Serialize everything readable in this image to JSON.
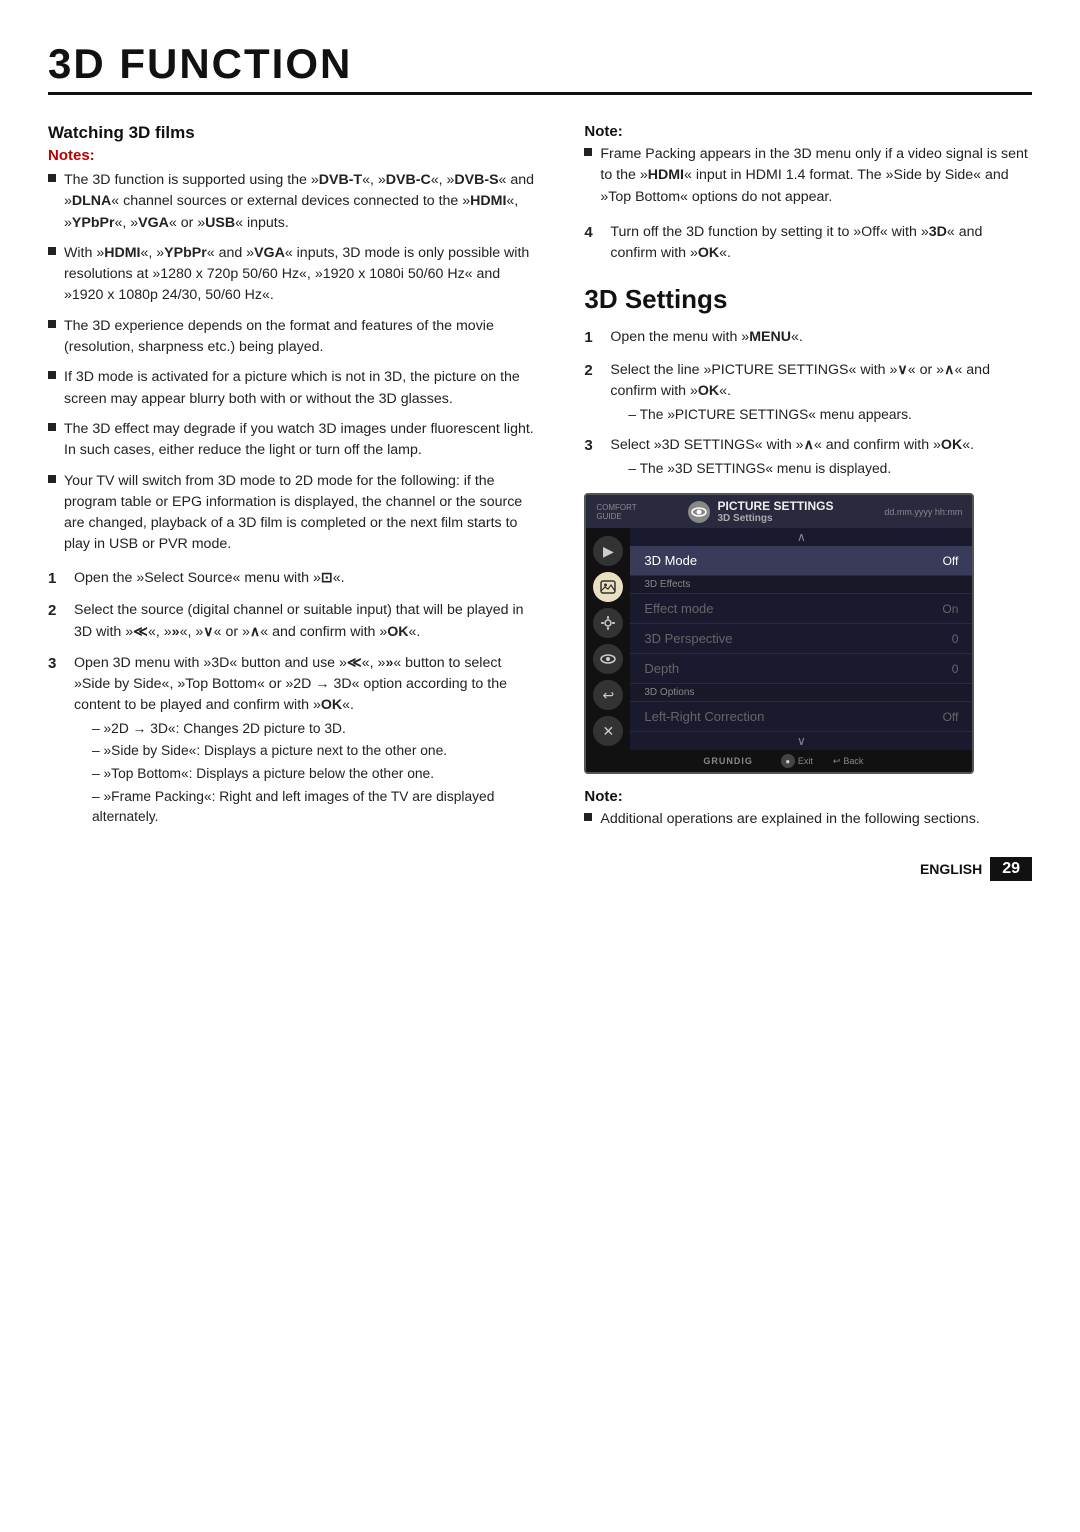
{
  "page": {
    "title": "3D FUNCTION",
    "footer_lang": "ENGLISH",
    "footer_page": "29"
  },
  "left_col": {
    "watching_heading": "Watching 3D films",
    "notes_label": "Notes:",
    "notes": [
      "The 3D function is supported using the »DVB-T«, »DVB-C«, »DVB-S« and »DLNA« channel sources or external devices connected to the »HDMI«, »YPbPr«, »VGA« or »USB« inputs.",
      "With »HDMI«, »YPbPr« and »VGA« inputs, 3D mode is only possible with resolutions at »1280 x 720p 50/60 Hz«, »1920 x 1080i 50/60 Hz« and »1920 x 1080p 24/30, 50/60 Hz«.",
      "The 3D experience depends on the format and features of the movie (resolution, sharpness etc.) being played.",
      "If 3D mode is activated for a picture which is not in 3D, the picture on the screen may appear blurry both with or without the 3D glasses.",
      "The 3D effect may degrade if you watch 3D images under fluorescent light. In such cases, either reduce the light or turn off the lamp.",
      "Your TV will switch from 3D mode to 2D mode for the following: if the program table or EPG information is displayed, the channel or the source are changed, playback of a 3D film is completed or the next film starts to play in USB or PVR mode."
    ],
    "steps": [
      {
        "num": "1",
        "text": "Open the »Select Source« menu with »",
        "icon_text": "⊡",
        "text_after": "«."
      },
      {
        "num": "2",
        "text": "Select the source (digital channel or suitable input) that will be played in 3D with »",
        "icon_text": "≪",
        "text_after": "«, »»«, »∨« or »∧« and confirm with »OK«."
      },
      {
        "num": "3",
        "text": "Open 3D menu with »3D« button and use »≪«, »»« button to select »Side by Side«, »Top Bottom« or »2D → 3D« option according to the content to be played and confirm with »OK«.",
        "sub_items": [
          "– »2D → 3D«: Changes 2D picture to 3D.",
          "– »Side by Side«: Displays a picture next to the other one.",
          "– »Top Bottom«: Displays a picture below the other one.",
          "– »Frame Packing«: Right and left images of the TV are displayed alternately."
        ]
      }
    ]
  },
  "right_col": {
    "note1_label": "Note:",
    "note1_bullets": [
      "Frame Packing appears in the 3D menu only if a video signal is sent to the »HDMI« input in HDMI 1.4 format. The »Side by Side« and »Top Bottom« options do not appear."
    ],
    "step4": {
      "num": "4",
      "text": "Turn off the 3D function by setting it to »Off« with »3D« and confirm with »OK«."
    },
    "settings_heading": "3D Settings",
    "settings_steps": [
      {
        "num": "1",
        "text": "Open the menu with »MENU«."
      },
      {
        "num": "2",
        "text": "Select the line »PICTURE SETTINGS« with »∨« or »∧« and confirm with »OK«.",
        "sub_items": [
          "– The »PICTURE SETTINGS« menu appears."
        ]
      },
      {
        "num": "3",
        "text": "Select »3D SETTINGS« with »∧« and confirm with »OK«.",
        "sub_items": [
          "– The »3D SETTINGS« menu is displayed."
        ]
      }
    ],
    "tv_menu": {
      "top_title": "PICTURE SETTINGS",
      "top_subtitle": "3D Settings",
      "top_time": "dd.mm.yyyy hh:mm",
      "menu_items": [
        {
          "label": "3D Mode",
          "value": "Off",
          "type": "active",
          "section": ""
        },
        {
          "label": "3D Effects",
          "value": "",
          "type": "section-label",
          "section": "3D Effects"
        },
        {
          "label": "Effect mode",
          "value": "On",
          "type": "dimmed",
          "section": ""
        },
        {
          "label": "3D Perspective",
          "value": "0",
          "type": "dimmed",
          "section": ""
        },
        {
          "label": "Depth",
          "value": "0",
          "type": "dimmed",
          "section": ""
        },
        {
          "label": "3D Options",
          "value": "",
          "type": "section-label",
          "section": "3D Options"
        },
        {
          "label": "Left-Right Correction",
          "value": "Off",
          "type": "dimmed",
          "section": ""
        }
      ],
      "sidebar_icons": [
        "▶",
        "📷",
        "📷",
        "👁",
        "↩",
        "✕"
      ],
      "bottom_labels": [
        "Exit",
        "Back"
      ],
      "brand": "GRUNDIG"
    },
    "note2_label": "Note:",
    "note2_bullets": [
      "Additional operations are explained in the following sections."
    ]
  }
}
